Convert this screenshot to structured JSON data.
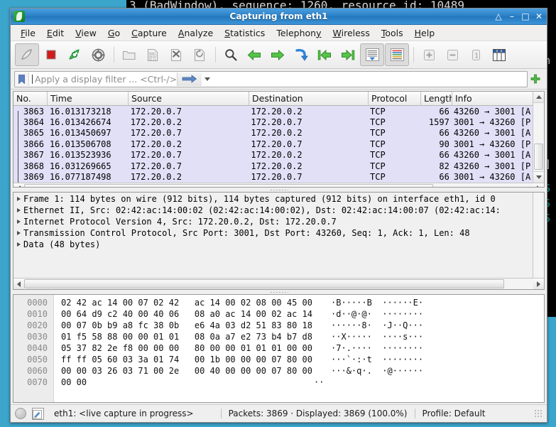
{
  "background": {
    "terminal_lines": [
      "3 (BadWindow), sequence: 1260, resource id: 10489",
      "m",
      "]",
      "S",
      "S",
      "S"
    ]
  },
  "window": {
    "title": "Capturing from eth1",
    "titlebar_buttons": [
      {
        "name": "shade-button",
        "glyph": "△"
      },
      {
        "name": "minimize-button",
        "glyph": "–"
      },
      {
        "name": "maximize-button",
        "glyph": "□"
      },
      {
        "name": "close-button",
        "glyph": "✕"
      }
    ]
  },
  "menu": [
    {
      "label": "File",
      "mnemonic": "F"
    },
    {
      "label": "Edit",
      "mnemonic": "E"
    },
    {
      "label": "View",
      "mnemonic": "V"
    },
    {
      "label": "Go",
      "mnemonic": "G"
    },
    {
      "label": "Capture",
      "mnemonic": "C"
    },
    {
      "label": "Analyze",
      "mnemonic": "A"
    },
    {
      "label": "Statistics",
      "mnemonic": "S"
    },
    {
      "label": "Telephony",
      "mnemonic": "y"
    },
    {
      "label": "Wireless",
      "mnemonic": "W"
    },
    {
      "label": "Tools",
      "mnemonic": "T"
    },
    {
      "label": "Help",
      "mnemonic": "H"
    }
  ],
  "toolbar": {
    "items": [
      {
        "name": "start-capture-icon",
        "title": "Start capturing packets"
      },
      {
        "name": "stop-capture-icon",
        "title": "Stop capturing packets"
      },
      {
        "name": "restart-capture-icon",
        "title": "Restart current capture"
      },
      {
        "name": "capture-options-icon",
        "title": "Capture options"
      },
      {
        "name": "open-file-icon",
        "title": "Open"
      },
      {
        "name": "save-file-icon",
        "title": "Save this capture file"
      },
      {
        "name": "close-file-icon",
        "title": "Close this capture file"
      },
      {
        "name": "reload-file-icon",
        "title": "Reload this file"
      },
      {
        "name": "find-packet-icon",
        "title": "Find a packet"
      },
      {
        "name": "go-back-icon",
        "title": "Go back in packet history"
      },
      {
        "name": "go-forward-icon",
        "title": "Go forward in packet history"
      },
      {
        "name": "go-to-packet-icon",
        "title": "Go to the packet with number"
      },
      {
        "name": "go-first-packet-icon",
        "title": "Go to the first packet"
      },
      {
        "name": "go-last-packet-icon",
        "title": "Go to the last packet"
      },
      {
        "name": "auto-scroll-icon",
        "title": "Auto scroll in live capture"
      },
      {
        "name": "colorize-icon",
        "title": "Colorize packet list"
      },
      {
        "name": "zoom-in-icon",
        "title": "Zoom in"
      },
      {
        "name": "zoom-out-icon",
        "title": "Zoom out"
      },
      {
        "name": "zoom-reset-icon",
        "title": "Normal size"
      },
      {
        "name": "resize-columns-icon",
        "title": "Resize columns"
      }
    ]
  },
  "filter": {
    "placeholder": "Apply a display filter ... <Ctrl-/>",
    "value": "",
    "bookmark_icon": "bookmark-icon",
    "apply_icon": "apply-filter-arrow-icon",
    "dropdown_icon": "chevron-down-icon",
    "add_icon": "add-filter-button-icon"
  },
  "packet_list": {
    "columns": [
      "No.",
      "Time",
      "Source",
      "Destination",
      "Protocol",
      "Length",
      "Info"
    ],
    "rows": [
      {
        "no": "3863",
        "time": "16.013173218",
        "source": "172.20.0.7",
        "destination": "172.20.0.2",
        "protocol": "TCP",
        "length": "66",
        "info": "43260 → 3001 [A"
      },
      {
        "no": "3864",
        "time": "16.013426674",
        "source": "172.20.0.2",
        "destination": "172.20.0.7",
        "protocol": "TCP",
        "length": "1597",
        "info": "3001 → 43260 [P"
      },
      {
        "no": "3865",
        "time": "16.013450697",
        "source": "172.20.0.7",
        "destination": "172.20.0.2",
        "protocol": "TCP",
        "length": "66",
        "info": "43260 → 3001 [A"
      },
      {
        "no": "3866",
        "time": "16.013506708",
        "source": "172.20.0.2",
        "destination": "172.20.0.7",
        "protocol": "TCP",
        "length": "90",
        "info": "3001 → 43260 [P"
      },
      {
        "no": "3867",
        "time": "16.013523936",
        "source": "172.20.0.7",
        "destination": "172.20.0.2",
        "protocol": "TCP",
        "length": "66",
        "info": "43260 → 3001 [A"
      },
      {
        "no": "3868",
        "time": "16.031269665",
        "source": "172.20.0.7",
        "destination": "172.20.0.2",
        "protocol": "TCP",
        "length": "82",
        "info": "43260 → 3001 [P"
      },
      {
        "no": "3869",
        "time": "16.077187498",
        "source": "172.20.0.2",
        "destination": "172.20.0.7",
        "protocol": "TCP",
        "length": "66",
        "info": "3001 → 43260 [A"
      }
    ]
  },
  "packet_detail": {
    "rows": [
      "Frame 1: 114 bytes on wire (912 bits), 114 bytes captured (912 bits) on interface eth1, id 0",
      "Ethernet II, Src: 02:42:ac:14:00:02 (02:42:ac:14:00:02), Dst: 02:42:ac:14:00:07 (02:42:ac:14:",
      "Internet Protocol Version 4, Src: 172.20.0.2, Dst: 172.20.0.7",
      "Transmission Control Protocol, Src Port: 3001, Dst Port: 43260, Seq: 1, Ack: 1, Len: 48",
      "Data (48 bytes)"
    ]
  },
  "packet_bytes": {
    "lines": [
      {
        "offset": "0000",
        "hex": "02 42 ac 14 00 07 02 42   ac 14 00 02 08 00 45 00",
        "ascii": "·B·····B  ······E·"
      },
      {
        "offset": "0010",
        "hex": "00 64 d9 c2 40 00 40 06   08 a0 ac 14 00 02 ac 14",
        "ascii": "·d··@·@·  ········"
      },
      {
        "offset": "0020",
        "hex": "00 07 0b b9 a8 fc 38 0b   e6 4a 03 d2 51 83 80 18",
        "ascii": "······8·  ·J··Q···"
      },
      {
        "offset": "0030",
        "hex": "01 f5 58 88 00 00 01 01   08 0a a7 e2 73 b4 b7 d8",
        "ascii": "··X·····  ····s···"
      },
      {
        "offset": "0040",
        "hex": "05 37 82 2e f8 00 00 00   80 00 00 01 01 01 00 00",
        "ascii": "·7·.····  ········"
      },
      {
        "offset": "0050",
        "hex": "ff ff 05 60 03 3a 01 74   00 1b 00 00 00 07 80 00",
        "ascii": "···`·:·t  ········"
      },
      {
        "offset": "0060",
        "hex": "00 00 03 26 03 71 00 2e   00 40 00 00 00 07 80 00",
        "ascii": "···&·q·.  ·@······"
      },
      {
        "offset": "0070",
        "hex": "00 00",
        "ascii": "··"
      }
    ]
  },
  "status_bar": {
    "capture_status": "eth1: <live capture in progress>",
    "packet_counts": "Packets: 3869 · Displayed: 3869 (100.0%)",
    "profile": "Profile: Default"
  },
  "colors": {
    "titlebar_accent": "#2b7fc4",
    "packet_row_bg": "#e2e0f7",
    "desktop": "#3ca5cc",
    "terminal_teal": "#17a0a0"
  }
}
